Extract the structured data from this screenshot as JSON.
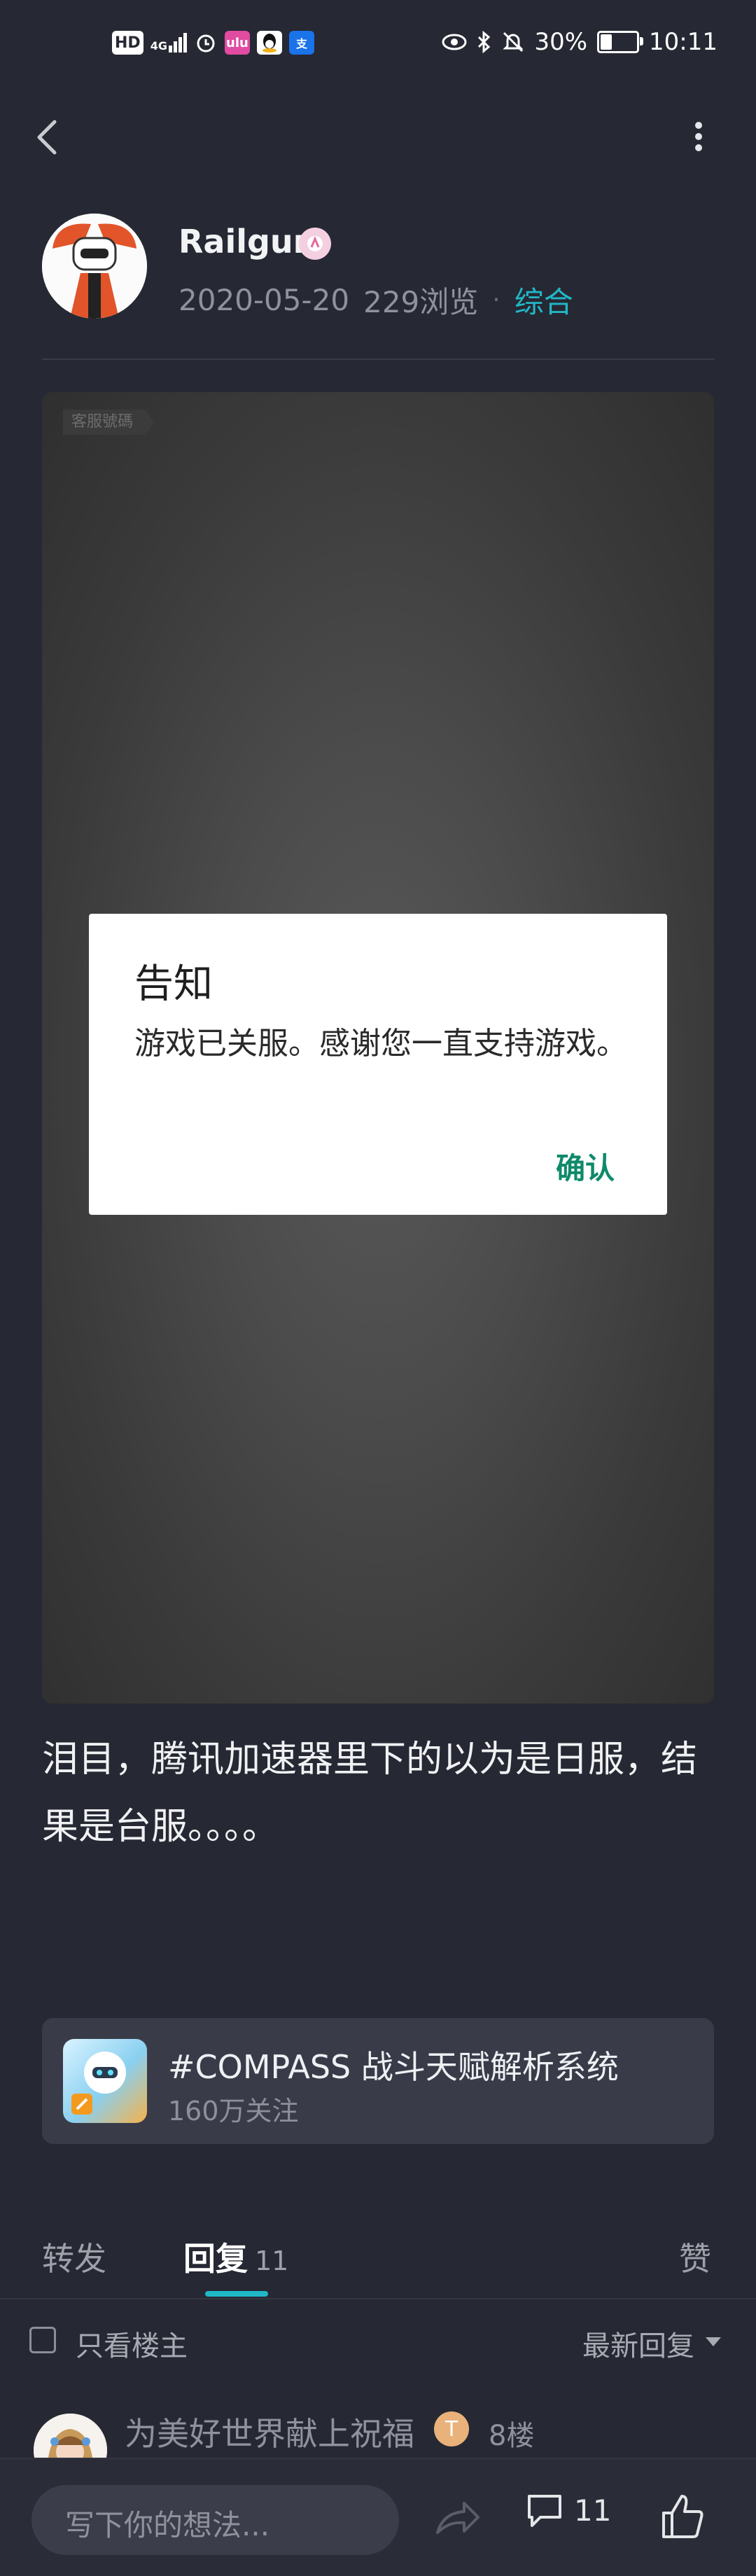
{
  "status_bar": {
    "hd": "HD",
    "network": "4G",
    "battery": "30%",
    "time": "10:11",
    "battery_level": 0.3
  },
  "nav": {
    "back_icon": "chevron-left-icon",
    "more_icon": "more-vertical-icon"
  },
  "author": {
    "name": "Railgun",
    "date": "2020-05-20",
    "views": "229浏览",
    "separator": "·",
    "category": "综合"
  },
  "post_image": {
    "tag": "客服號碼",
    "dialog": {
      "title": "告知",
      "body": "游戏已关服。感谢您一直支持游戏。",
      "button": "确认"
    }
  },
  "post": {
    "text": "泪目，腾讯加速器里下的以为是日服，结果是台服。。。。"
  },
  "topic": {
    "title": "#COMPASS 战斗天赋解析系统",
    "followers": "160万关注"
  },
  "tabs": [
    {
      "label": "转发",
      "count": ""
    },
    {
      "label": "回复",
      "count": "11"
    },
    {
      "label": "赞",
      "count": ""
    }
  ],
  "filter": {
    "only_op": "只看楼主",
    "sort": "最新回复"
  },
  "comment_preview": {
    "name": "为美好世界献上祝福",
    "badge": "T",
    "floor": "8楼"
  },
  "bottom_bar": {
    "placeholder": "写下你的想法...",
    "comment_count": "11"
  },
  "colors": {
    "background": "#262833",
    "accent": "#1fb8c7",
    "dialog_button": "#0e8a6b"
  }
}
